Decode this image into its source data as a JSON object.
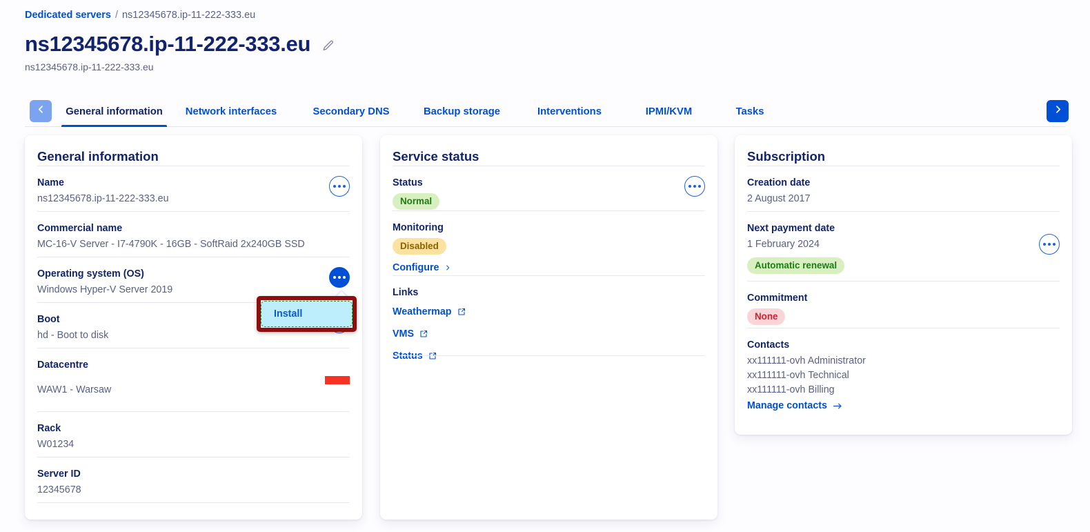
{
  "breadcrumb": {
    "root": "Dedicated servers",
    "separator": "/",
    "current": "ns12345678.ip-11-222-333.eu"
  },
  "header": {
    "title": "ns12345678.ip-11-222-333.eu",
    "subtitle": "ns12345678.ip-11-222-333.eu",
    "edit_icon": "pencil-icon"
  },
  "tabs": {
    "prev_icon": "chevron-left-icon",
    "next_icon": "chevron-right-icon",
    "items": [
      {
        "label": "General information",
        "active": true
      },
      {
        "label": "Network interfaces",
        "active": false
      },
      {
        "label": "Secondary DNS",
        "active": false
      },
      {
        "label": "Backup storage",
        "active": false
      },
      {
        "label": "Interventions",
        "active": false
      },
      {
        "label": "IPMI/KVM",
        "active": false
      },
      {
        "label": "Tasks",
        "active": false
      }
    ]
  },
  "general_information": {
    "title": "General information",
    "rows": [
      {
        "label": "Name",
        "value": "ns12345678.ip-11-222-333.eu"
      },
      {
        "label": "Commercial name",
        "value": "MC-16-V Server - I7-4790K - 16GB - SoftRaid 2x240GB SSD"
      },
      {
        "label": "Operating system (OS)",
        "value": "Windows Hyper-V Server 2019"
      },
      {
        "label": "Boot",
        "value": "hd - Boot to disk"
      },
      {
        "label": "Datacentre",
        "value": "WAW1 - Warsaw"
      },
      {
        "label": "Rack",
        "value": "W01234"
      },
      {
        "label": "Server ID",
        "value": "12345678"
      }
    ]
  },
  "service_status": {
    "title": "Service status",
    "status_label": "Status",
    "status_badge": "Normal",
    "monitoring_label": "Monitoring",
    "monitoring_badge": "Disabled",
    "configure_link": "Configure",
    "links_label": "Links",
    "links": [
      {
        "label": "Weathermap"
      },
      {
        "label": "VMS"
      },
      {
        "label": "Status"
      }
    ]
  },
  "subscription": {
    "title": "Subscription",
    "creation_date_label": "Creation date",
    "creation_date_value": "2 August 2017",
    "next_payment_label": "Next payment date",
    "next_payment_value": "1 February 2024",
    "renewal_badge": "Automatic renewal",
    "commitment_label": "Commitment",
    "commitment_badge": "None",
    "contacts_label": "Contacts",
    "contacts": [
      "xx111111-ovh Administrator",
      "xx111111-ovh Technical",
      "xx111111-ovh Billing"
    ],
    "manage_contacts_link": "Manage contacts"
  },
  "install_popover": {
    "item_label": "Install"
  },
  "colors": {
    "brand_blue": "#0050d7",
    "title_navy": "#12246b",
    "muted_text": "#5a5f86",
    "badge_green_bg": "#d8f0bf",
    "badge_green_text": "#1d7b17",
    "badge_yellow_bg": "#fbe2a1",
    "badge_yellow_text": "#8a6200",
    "badge_red_bg": "#fad5d7",
    "badge_red_text": "#cc2230",
    "highlight_border": "#8b0f0f",
    "highlight_item_bg": "#bdeefb",
    "highlight_item_border": "#2e8b30",
    "flag_red": "#f73123"
  }
}
